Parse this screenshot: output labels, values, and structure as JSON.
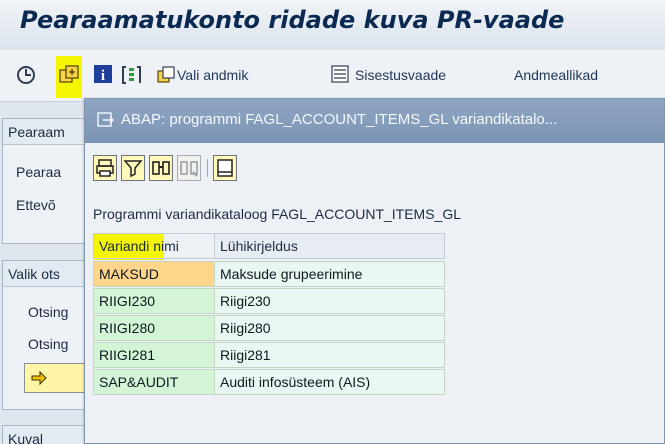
{
  "window": {
    "title": "Pearaamatukonto ridade kuva PR-vaade"
  },
  "toolbar": {
    "icons": [
      "execute-icon",
      "get-variant-icon",
      "info-icon",
      "dynamic-selection-icon"
    ],
    "vali_andmik_label": "Vali andmik",
    "sisestusvaade_label": "Sisestusvaade",
    "andmeallikad_label": "Andmeallikad"
  },
  "background": {
    "panel1_title": "Pearaam",
    "row_pearaamatukonto": "Pearaa",
    "row_ettevote": "Ettevõ",
    "panel2_title": "Valik ots",
    "row_otsing1": "Otsing",
    "row_otsing2": "Otsing",
    "panel3_title": "Kuval"
  },
  "dialog": {
    "title": "ABAP: programmi FAGL_ACCOUNT_ITEMS_GL variandikatalo...",
    "catalog_label": "Programmi variandikataloog FAGL_ACCOUNT_ITEMS_GL",
    "columns": [
      "Variandi nimi",
      "Lühikirjeldus"
    ],
    "rows": [
      {
        "name": "MAKSUD",
        "desc": "Maksude grupeerimine",
        "selected": true
      },
      {
        "name": "RIIGI230",
        "desc": "Riigi230",
        "selected": false
      },
      {
        "name": "RIIGI280",
        "desc": "Riigi280",
        "selected": false
      },
      {
        "name": "RIIGI281",
        "desc": "Riigi281",
        "selected": false
      },
      {
        "name": "SAP&AUDIT",
        "desc": "Auditi infosüsteem (AIS)",
        "selected": false
      }
    ]
  },
  "colors": {
    "highlight": "#f4f500",
    "selected_row": "#ffd58c",
    "name_cell": "#d3f5d6",
    "desc_cell": "#e8f7f2",
    "dialog_titlebar": "#7c95b4"
  }
}
